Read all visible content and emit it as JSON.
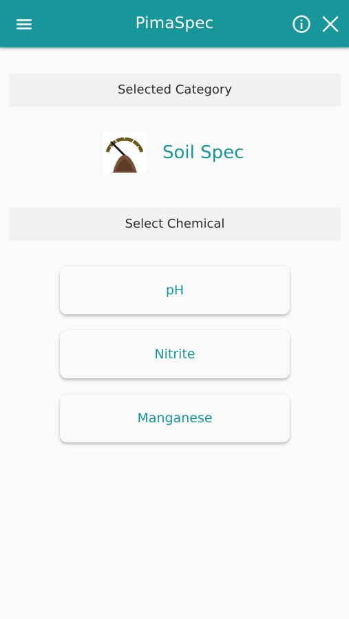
{
  "appbar": {
    "title": "PimaSpec",
    "menu_icon": "menu-icon",
    "info_icon": "info-icon",
    "close_icon": "close-icon",
    "color": "#17979a"
  },
  "selected_category": {
    "header": "Selected Category",
    "icon": "soil-gauge-icon",
    "label": "Soil Spec"
  },
  "select_chemical": {
    "header": "Select Chemical",
    "options": [
      "pH",
      "Nitrite",
      "Manganese"
    ]
  }
}
